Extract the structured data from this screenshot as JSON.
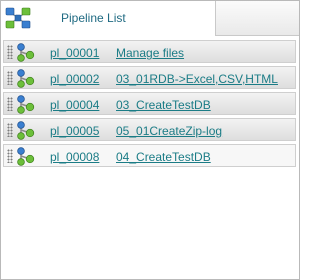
{
  "panel": {
    "tab": {
      "label": "Pipeline List",
      "icon": "pipeline-network-icon"
    }
  },
  "pipelines": [
    {
      "id": "pl_00001",
      "name": "Manage files",
      "icon": "pipeline-node-icon"
    },
    {
      "id": "pl_00002",
      "name": "03_01RDB->Excel,CSV,HTML",
      "icon": "pipeline-node-icon"
    },
    {
      "id": "pl_00004",
      "name": "03_CreateTestDB",
      "icon": "pipeline-node-icon"
    },
    {
      "id": "pl_00005",
      "name": "05_01CreateZip-log",
      "icon": "pipeline-node-icon"
    },
    {
      "id": "pl_00008",
      "name": "04_CreateTestDB",
      "icon": "pipeline-node-icon"
    }
  ],
  "colors": {
    "link": "#1b7c86",
    "tab_label": "#1f6a82",
    "node_blue": "#3a7fd0",
    "node_green": "#6cbf3a"
  }
}
